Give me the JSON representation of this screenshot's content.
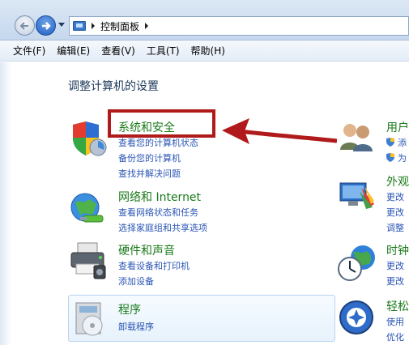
{
  "address": {
    "crumb": "控制面板"
  },
  "menu": [
    "文件(F)",
    "编辑(E)",
    "查看(V)",
    "工具(T)",
    "帮助(H)"
  ],
  "page_title": "调整计算机的设置",
  "left_categories": [
    {
      "title": "系统和安全",
      "links": [
        "查看您的计算机状态",
        "备份您的计算机",
        "查找并解决问题"
      ]
    },
    {
      "title": "网络和 Internet",
      "links": [
        "查看网络状态和任务",
        "选择家庭组和共享选项"
      ]
    },
    {
      "title": "硬件和声音",
      "links": [
        "查看设备和打印机",
        "添加设备"
      ]
    },
    {
      "title": "程序",
      "links": [
        "卸载程序"
      ]
    }
  ],
  "right_categories": [
    {
      "title": "用户",
      "links": [
        "添",
        "为"
      ]
    },
    {
      "title": "外观",
      "links": [
        "更改",
        "更改",
        "调整"
      ]
    },
    {
      "title": "时钟",
      "links": [
        "更改",
        "更改"
      ]
    },
    {
      "title": "轻松",
      "links": [
        "使用",
        "优化"
      ]
    }
  ],
  "colors": {
    "accent_green": "#1a7a1a",
    "link_blue": "#2a55b5",
    "highlight_red": "#b11a1a"
  }
}
